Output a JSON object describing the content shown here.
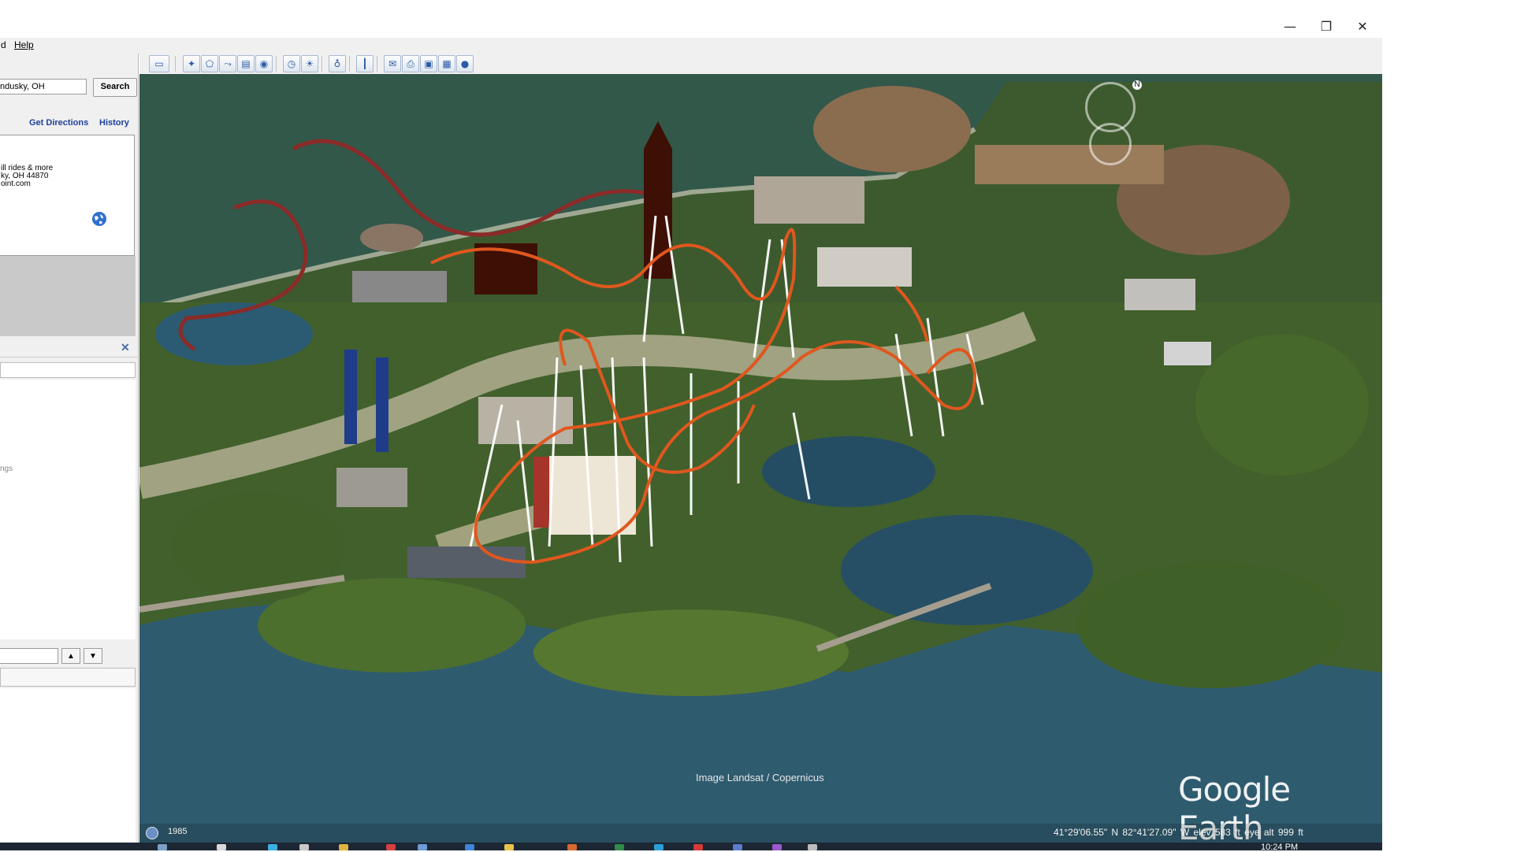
{
  "menu": {
    "item1_fragment": "d",
    "help_label": "Help"
  },
  "window_controls": {
    "minimize": "—",
    "restore": "❐",
    "close": "✕"
  },
  "search": {
    "value": "ndusky, OH",
    "button_label": "Search"
  },
  "links": {
    "get_directions": "Get Directions",
    "history": "History"
  },
  "result_card": {
    "line1": "ill rides & more",
    "line2": "ky, OH 44870",
    "line3": "oint.com"
  },
  "places": {
    "fragment": "ngs",
    "close_label": "✕"
  },
  "arrows": {
    "up": "▲",
    "down": "▼"
  },
  "map": {
    "attribution": "Image Landsat / Copernicus",
    "logo": "Google Earth",
    "year": "1985",
    "coordinates": "41°29'06.55\" N   82°41'27.09\" W   elev   583 ft    eye alt   999 ft"
  },
  "taskbar": {
    "clock": "10:24 PM"
  },
  "colors": {
    "coaster_orange": "#e0571e",
    "support_white": "#ffffff",
    "tower_brown": "#3d0f05",
    "water": "#2f5b6f"
  }
}
